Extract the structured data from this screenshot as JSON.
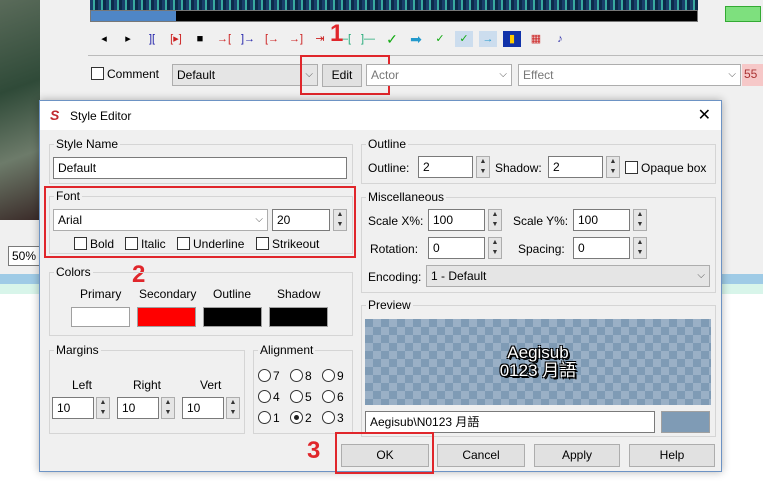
{
  "background_app": {
    "audio_progress_percent": 14,
    "comment_label": "Comment",
    "style_value": "Default",
    "edit_button": "Edit",
    "actor_placeholder": "Actor",
    "effect_placeholder": "Effect",
    "layer_value": "55",
    "zoom_value": "50%"
  },
  "annotations": {
    "step1": "1",
    "step2": "2",
    "step3": "3"
  },
  "dialog": {
    "title": "Style Editor",
    "style_name": {
      "label": "Style Name",
      "value": "Default"
    },
    "font": {
      "label": "Font",
      "name": "Arial",
      "size": "20",
      "bold": "Bold",
      "italic": "Italic",
      "underline": "Underline",
      "strikeout": "Strikeout"
    },
    "colors": {
      "label": "Colors",
      "primary": "Primary",
      "secondary": "Secondary",
      "outline": "Outline",
      "shadow": "Shadow",
      "primary_color": "#ffffff",
      "secondary_color": "#ff0000",
      "outline_color": "#000000",
      "shadow_color": "#000000"
    },
    "margins": {
      "label": "Margins",
      "left_label": "Left",
      "right_label": "Right",
      "vert_label": "Vert",
      "left": "10",
      "right": "10",
      "vert": "10"
    },
    "alignment": {
      "label": "Alignment",
      "options": [
        "7",
        "8",
        "9",
        "4",
        "5",
        "6",
        "1",
        "2",
        "3"
      ],
      "selected": "2"
    },
    "outline": {
      "label": "Outline",
      "outline_label": "Outline:",
      "outline_value": "2",
      "shadow_label": "Shadow:",
      "shadow_value": "2",
      "opaque_box": "Opaque box"
    },
    "misc": {
      "label": "Miscellaneous",
      "scale_x_label": "Scale X%:",
      "scale_x": "100",
      "scale_y_label": "Scale Y%:",
      "scale_y": "100",
      "rotation_label": "Rotation:",
      "rotation": "0",
      "spacing_label": "Spacing:",
      "spacing": "0",
      "encoding_label": "Encoding:",
      "encoding": "1 - Default"
    },
    "preview": {
      "label": "Preview",
      "line1": "Aegisub",
      "line2": "0123 月語",
      "text": "Aegisub\\N0123 月語",
      "bg_color": "#7f9bb5"
    },
    "buttons": {
      "ok": "OK",
      "cancel": "Cancel",
      "apply": "Apply",
      "help": "Help"
    }
  }
}
